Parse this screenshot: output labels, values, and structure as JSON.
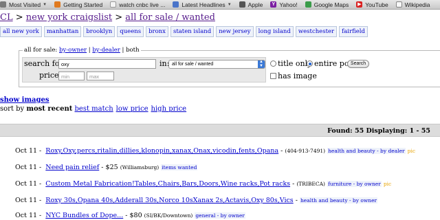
{
  "bookmarks": [
    {
      "label": "Most Visited",
      "icon": "gear-icon",
      "has_caret": true
    },
    {
      "label": "Getting Started",
      "icon": "firefox-icon",
      "has_caret": false
    },
    {
      "label": "watch cnbc live ...",
      "icon": "page-icon",
      "has_caret": false
    },
    {
      "label": "Latest Headlines",
      "icon": "rss-icon",
      "has_caret": true
    },
    {
      "label": "Apple",
      "icon": "apple-icon",
      "has_caret": false
    },
    {
      "label": "Yahoo!",
      "icon": "yahoo-icon",
      "has_caret": false
    },
    {
      "label": "Google Maps",
      "icon": "maps-icon",
      "has_caret": false
    },
    {
      "label": "YouTube",
      "icon": "youtube-icon",
      "has_caret": false
    },
    {
      "label": "Wikipedia",
      "icon": "wikipedia-icon",
      "has_caret": false
    }
  ],
  "breadcrumb": {
    "site": "CL",
    "sep1": ">",
    "city": "new york craigslist",
    "sep2": ">",
    "category": "all for sale / wanted"
  },
  "neighborhoods": [
    "all new york",
    "manhattan",
    "brooklyn",
    "queens",
    "bronx",
    "staten island",
    "new jersey",
    "long island",
    "westchester",
    "fairfield"
  ],
  "search": {
    "legend_prefix": "all for sale:",
    "by_owner": "by-owner",
    "sep1": "|",
    "by_dealer": "by-dealer",
    "sep2": "|",
    "both": "both",
    "search_for_label": "search for:",
    "query": "oxy",
    "in_label": "in:",
    "in_value": "all for sale / wanted",
    "price_label": "price:",
    "min_placeholder": "min",
    "max_placeholder": "max",
    "title_only_label": "title only",
    "entire_post_label": "entire post",
    "search_button": "Search",
    "has_image_label": "has image"
  },
  "show_images": "show images",
  "sort": {
    "prefix": "sort by",
    "current": "most recent",
    "options": [
      "best match",
      "low price",
      "high price"
    ]
  },
  "found": "Found: 55 Displaying: 1 - 55",
  "listings": [
    {
      "date": "Oct 11 -",
      "title": "Roxy,Oxy,percs,ritalin,dillies,klonopin,xanax,Onax,vicodin,fents,Opana",
      "price": "-",
      "location": "(404-913-7491)",
      "category": "health and beauty - by dealer",
      "pic": "pic"
    },
    {
      "date": "Oct 11 -",
      "title": "Need pain relief",
      "price": "- $25",
      "location": "(Williamsburg)",
      "category": "items wanted",
      "pic": ""
    },
    {
      "date": "Oct 11 -",
      "title": "Custom Metal Fabrication!Tables,Chairs,Bars,Doors,Wine racks,Pot racks",
      "price": "-",
      "location": "(TRIBECA)",
      "category": "furniture - by owner",
      "pic": "pic"
    },
    {
      "date": "Oct 11 -",
      "title": "Roxy 30s,Opana 40s,Adderall 30s,Norco 10sXanax 2s,Actavis,Oxy 80s,Vics",
      "price": "-",
      "location": "",
      "category": "health and beauty - by owner",
      "pic": ""
    },
    {
      "date": "Oct 11 -",
      "title": "NYC Bundles of Dope...",
      "price": "- $80",
      "location": "(SI/BK/Downtown)",
      "category": "general - by owner",
      "pic": ""
    }
  ],
  "colors": {
    "link": "#0000cc",
    "visited": "#551a8b",
    "pic": "#e8a300",
    "found_bar": "#dcdcdc"
  }
}
